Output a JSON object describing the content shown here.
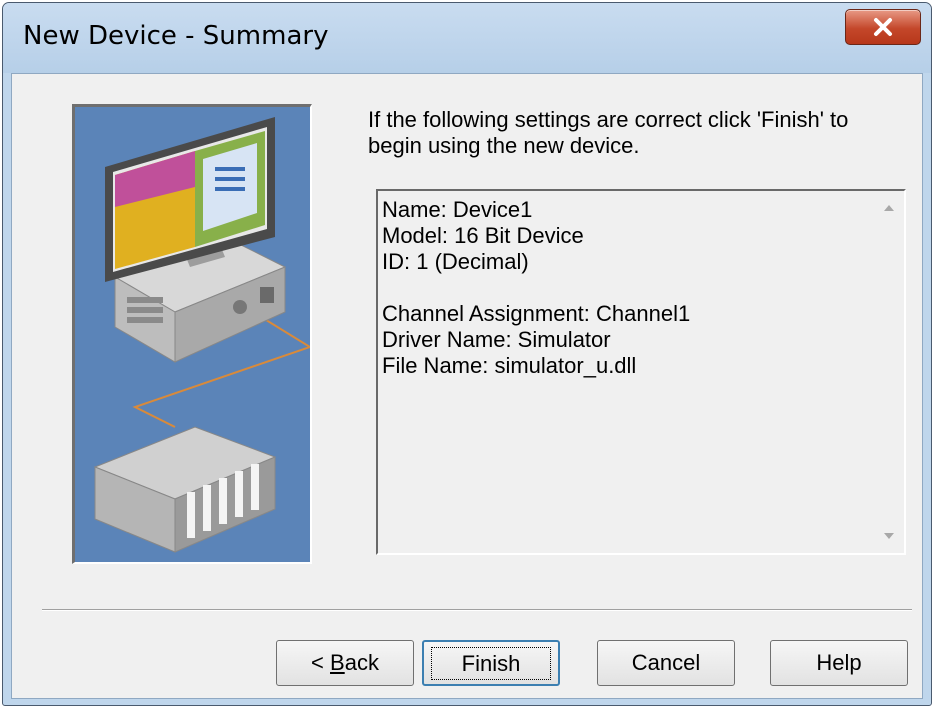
{
  "window": {
    "title": "New Device - Summary",
    "close_icon": "close-icon"
  },
  "intro_text": "If the following settings are correct click 'Finish' to begin using the new device.",
  "summary": {
    "lines": [
      "Name: Device1",
      "Model: 16 Bit Device",
      "ID: 1 (Decimal)",
      "",
      "Channel Assignment: Channel1",
      "Driver Name: Simulator",
      "File Name: simulator_u.dll"
    ]
  },
  "buttons": {
    "back_prefix": "< ",
    "back_mnemonic": "B",
    "back_rest": "ack",
    "finish": "Finish",
    "cancel": "Cancel",
    "help": "Help"
  },
  "colors": {
    "illustration_bg": "#5b84b8",
    "close_button": "#c4472a",
    "default_button_border": "#3c7fb1"
  }
}
